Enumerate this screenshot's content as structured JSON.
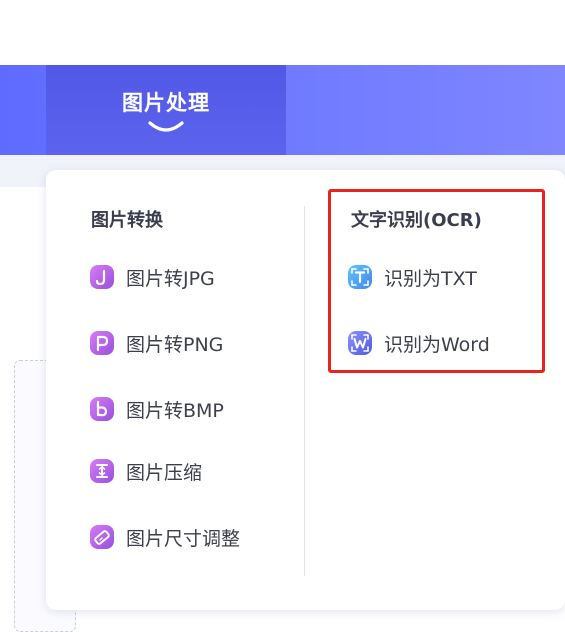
{
  "nav": {
    "active_tab_label": "图片处理"
  },
  "dropdown": {
    "image_conversion": {
      "title": "图片转换",
      "items": [
        {
          "label": "图片转JPG",
          "icon": "jpg-icon"
        },
        {
          "label": "图片转PNG",
          "icon": "png-icon"
        },
        {
          "label": "图片转BMP",
          "icon": "bmp-icon"
        },
        {
          "label": "图片压缩",
          "icon": "compress-icon"
        },
        {
          "label": "图片尺寸调整",
          "icon": "resize-icon"
        }
      ]
    },
    "ocr": {
      "title": "文字识别(OCR)",
      "items": [
        {
          "label": "识别为TXT",
          "icon": "txt-icon"
        },
        {
          "label": "识别为Word",
          "icon": "word-icon"
        }
      ]
    }
  },
  "colors": {
    "nav_gradient_start": "#5f6bff",
    "nav_gradient_end": "#7f86ff",
    "active_tab": "#5258e6",
    "conversion_icon": "#b05de8",
    "txt_icon": "#4fa6f5",
    "word_icon": "#6a72ea",
    "highlight": "#e8251c"
  }
}
